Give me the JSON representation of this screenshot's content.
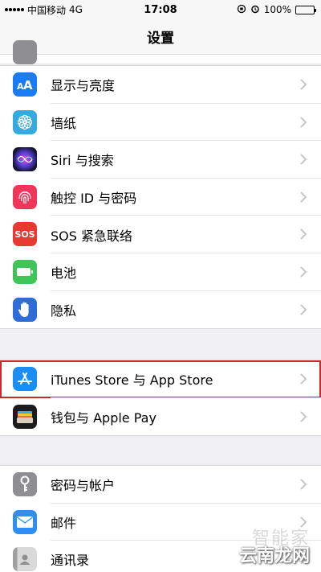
{
  "status_bar": {
    "carrier": "中国移动",
    "network": "4G",
    "time": "17:08",
    "battery": "100%"
  },
  "nav": {
    "title": "设置"
  },
  "groups": [
    {
      "items": [
        {
          "label": "显示与亮度",
          "icon": "display-brightness-icon",
          "color": "#1a7cf5"
        },
        {
          "label": "墙纸",
          "icon": "wallpaper-flower-icon",
          "color": "#35aadc"
        },
        {
          "label": "Siri 与搜索",
          "icon": "siri-icon",
          "color": "#2b2a5a"
        },
        {
          "label": "触控 ID 与密码",
          "icon": "fingerprint-icon",
          "color": "#f0365b"
        },
        {
          "label": "SOS 紧急联络",
          "icon": "sos-icon",
          "color": "#e83a32",
          "icon_text": "SOS"
        },
        {
          "label": "电池",
          "icon": "battery-icon",
          "color": "#3fc457"
        },
        {
          "label": "隐私",
          "icon": "hand-icon",
          "color": "#2f6cd8"
        }
      ]
    },
    {
      "items": [
        {
          "label": "iTunes Store 与 App Store",
          "icon": "app-store-icon",
          "color": "#1b8df5",
          "highlighted": true
        },
        {
          "label": "钱包与 Apple Pay",
          "icon": "wallet-icon",
          "color": "#1c1c1e"
        }
      ]
    },
    {
      "items": [
        {
          "label": "密码与帐户",
          "icon": "key-icon",
          "color": "#8e8e93"
        },
        {
          "label": "邮件",
          "icon": "mail-icon",
          "color": "#2e8ef5"
        },
        {
          "label": "通讯录",
          "icon": "contacts-icon",
          "color": "#b8b8b8"
        }
      ]
    }
  ],
  "watermark": {
    "top": "智能家",
    "bottom": "云南龙网"
  }
}
